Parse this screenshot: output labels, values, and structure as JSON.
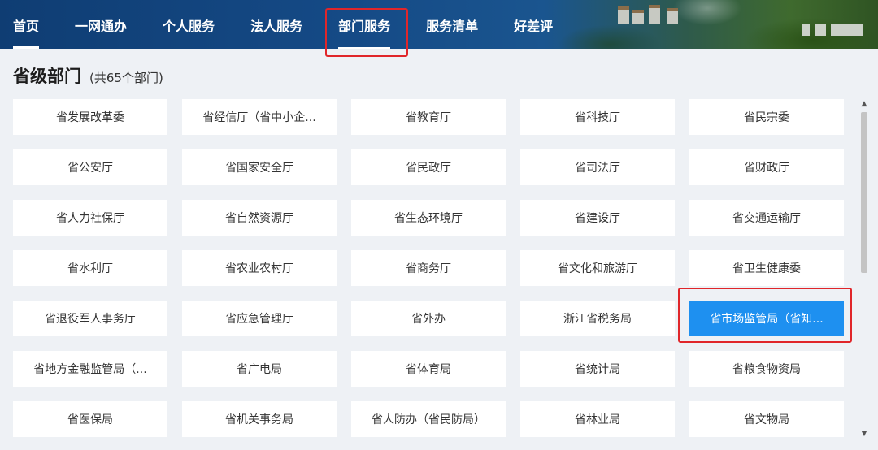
{
  "nav": {
    "items": [
      {
        "label": "首页"
      },
      {
        "label": "一网通办"
      },
      {
        "label": "个人服务"
      },
      {
        "label": "法人服务"
      },
      {
        "label": "部门服务"
      },
      {
        "label": "服务清单"
      },
      {
        "label": "好差评"
      }
    ],
    "active_index": 4
  },
  "section": {
    "title": "省级部门",
    "count": "(共65个部门)"
  },
  "departments": [
    "省发展改革委",
    "省经信厅（省中小企...",
    "省教育厅",
    "省科技厅",
    "省民宗委",
    "省公安厅",
    "省国家安全厅",
    "省民政厅",
    "省司法厅",
    "省财政厅",
    "省人力社保厅",
    "省自然资源厅",
    "省生态环境厅",
    "省建设厅",
    "省交通运输厅",
    "省水利厅",
    "省农业农村厅",
    "省商务厅",
    "省文化和旅游厅",
    "省卫生健康委",
    "省退役军人事务厅",
    "省应急管理厅",
    "省外办",
    "浙江省税务局",
    "省市场监管局（省知...",
    "省地方金融监管局（...",
    "省广电局",
    "省体育局",
    "省统计局",
    "省粮食物资局",
    "省医保局",
    "省机关事务局",
    "省人防办（省民防局）",
    "省林业局",
    "省文物局"
  ],
  "selected_department_index": 24,
  "colors": {
    "selected": "#1e90f0",
    "highlight": "#e0262a",
    "nav_bg": "#154a86"
  },
  "icons": {
    "scroll_up": "▲",
    "scroll_down": "▼"
  }
}
